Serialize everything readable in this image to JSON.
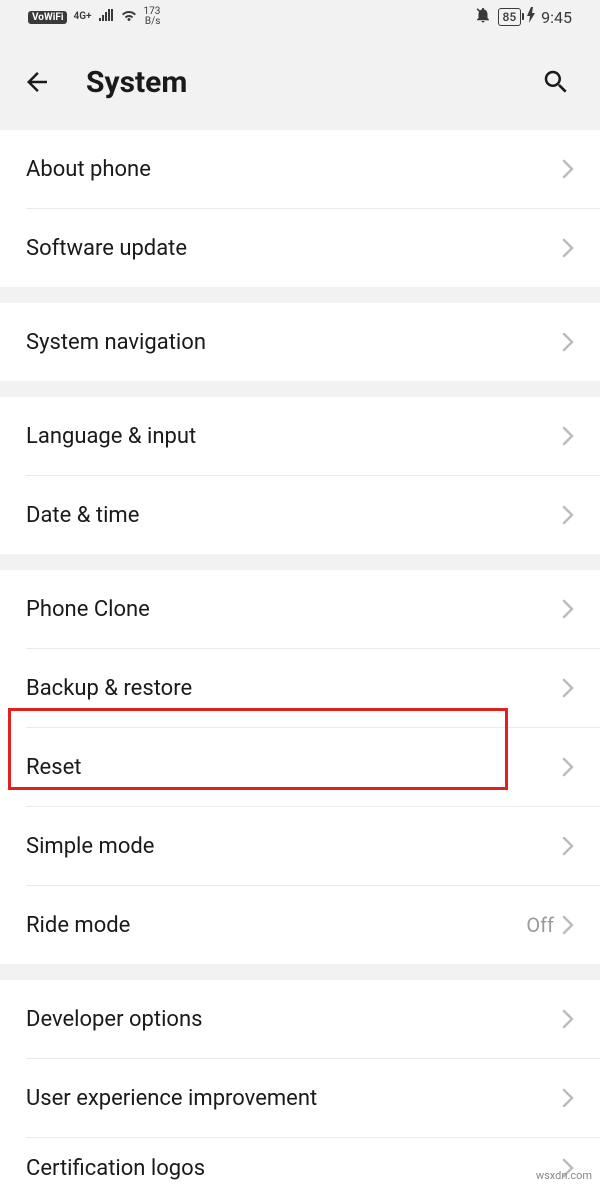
{
  "status": {
    "vowifi": "VoWiFi",
    "network_label": "4G+",
    "speed_value": "173",
    "speed_unit": "B/s",
    "battery": "85",
    "time": "9:45"
  },
  "header": {
    "title": "System"
  },
  "groups": [
    {
      "items": [
        {
          "key": "about-phone",
          "label": "About phone"
        },
        {
          "key": "software-update",
          "label": "Software update"
        }
      ]
    },
    {
      "items": [
        {
          "key": "system-navigation",
          "label": "System navigation"
        }
      ]
    },
    {
      "items": [
        {
          "key": "language-input",
          "label": "Language & input"
        },
        {
          "key": "date-time",
          "label": "Date & time"
        }
      ]
    },
    {
      "items": [
        {
          "key": "phone-clone",
          "label": "Phone Clone"
        },
        {
          "key": "backup-restore",
          "label": "Backup & restore"
        },
        {
          "key": "reset",
          "label": "Reset",
          "highlighted": true
        },
        {
          "key": "simple-mode",
          "label": "Simple mode"
        },
        {
          "key": "ride-mode",
          "label": "Ride mode",
          "value": "Off"
        }
      ]
    },
    {
      "items": [
        {
          "key": "developer-options",
          "label": "Developer options"
        },
        {
          "key": "user-experience",
          "label": "User experience improvement"
        },
        {
          "key": "certification-logos",
          "label": "Certification logos"
        }
      ]
    }
  ],
  "watermark": "wsxdn.com"
}
